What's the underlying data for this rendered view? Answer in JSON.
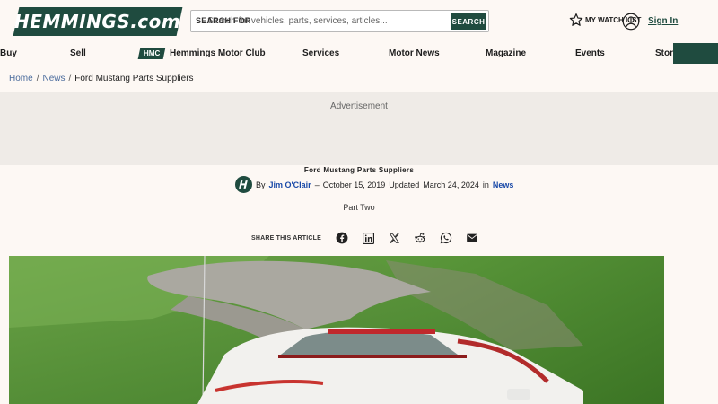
{
  "header": {
    "logo_text": "HEMMINGS.com",
    "search_label": "SEARCH FOR",
    "search_placeholder": "Search for vehicles, parts, services, articles...",
    "search_button": "SEARCH",
    "watch_list": "MY WATCH LIST",
    "sign_in": "Sign In"
  },
  "nav": {
    "items": [
      "Buy",
      "Sell",
      "Hemmings Motor Club",
      "Services",
      "Motor News",
      "Magazine",
      "Events",
      "Store"
    ],
    "hmc_badge": "HMC"
  },
  "breadcrumb": {
    "home": "Home",
    "news": "News",
    "current": "Ford Mustang Parts Suppliers"
  },
  "ad": {
    "label": "Advertisement"
  },
  "article": {
    "title": "Ford Mustang Parts Suppliers",
    "by": "By",
    "author": "Jim O'Clair",
    "dash": "–",
    "date": "October 15, 2019",
    "updated_label": "Updated",
    "updated_date": "March 24, 2024",
    "in": "in",
    "category": "News",
    "subtitle": "Part Two"
  },
  "share": {
    "label": "SHARE THIS ARTICLE",
    "icons": [
      "facebook-icon",
      "linkedin-icon",
      "x-icon",
      "reddit-icon",
      "whatsapp-icon",
      "email-icon"
    ]
  },
  "colors": {
    "brand_green": "#1f4b3f",
    "link_blue": "#1a4aa8",
    "page_bg": "#fdf8f4",
    "ad_bg": "#efebe7"
  }
}
